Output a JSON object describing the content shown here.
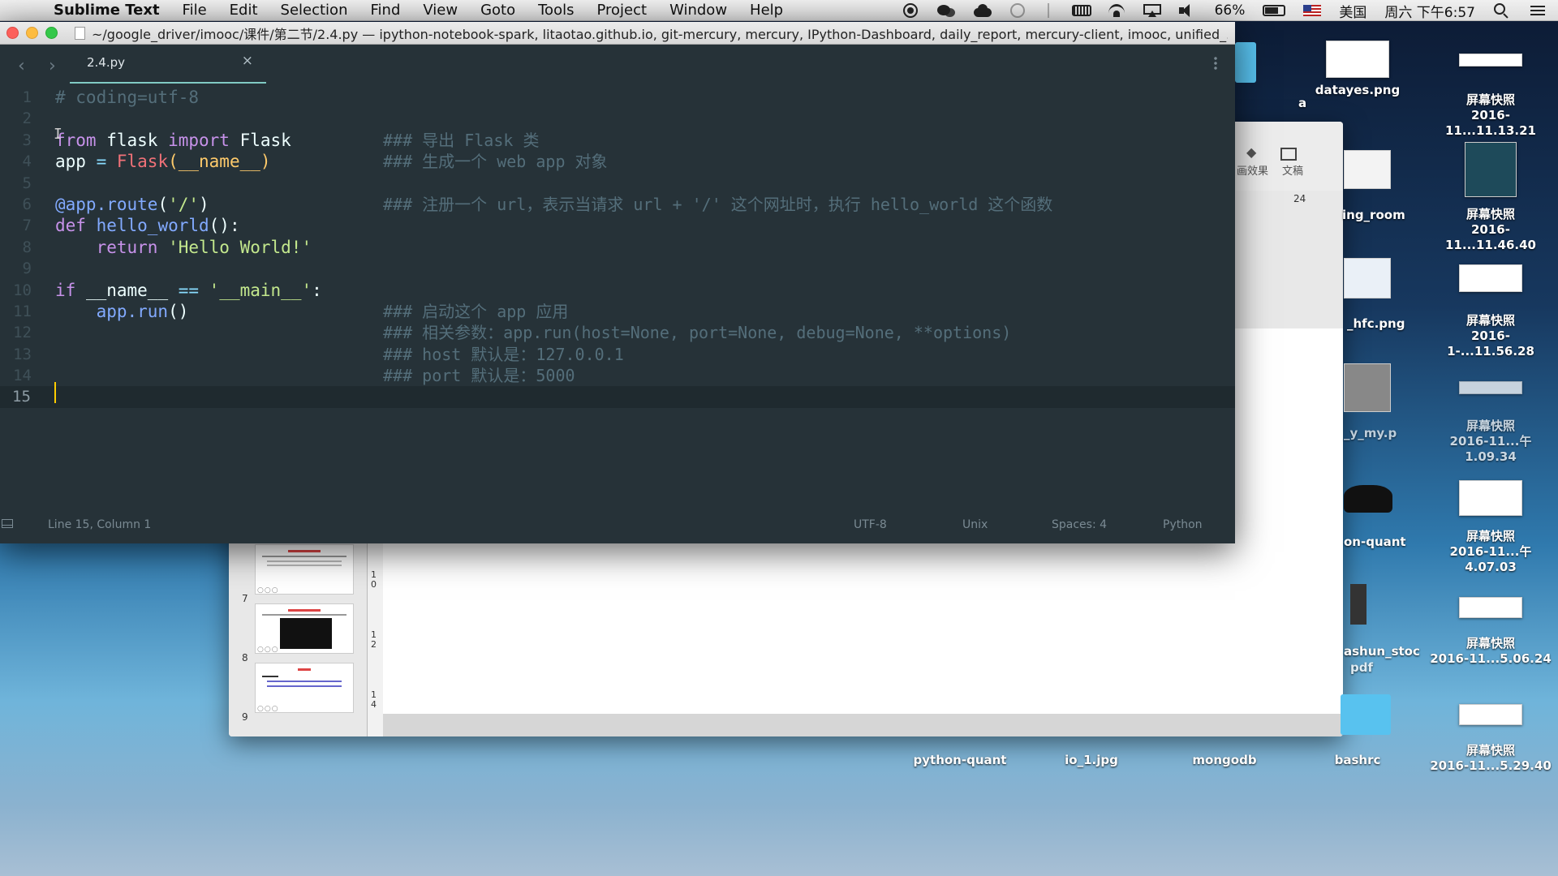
{
  "menubar": {
    "app_name": "Sublime Text",
    "items": [
      "File",
      "Edit",
      "Selection",
      "Find",
      "View",
      "Goto",
      "Tools",
      "Project",
      "Window",
      "Help"
    ],
    "battery": "66%",
    "input_source": "美国",
    "clock": "周六 下午6:57"
  },
  "window": {
    "title": "~/google_driver/imooc/课件/第二节/2.4.py — ipython-notebook-spark, litaotao.github.io, git-mercury, mercury, IPython-Dashboard, daily_report, mercury-client, imooc, unified_..."
  },
  "tab": {
    "label": "2.4.py",
    "close": "×"
  },
  "editor": {
    "line_numbers": [
      "1",
      "2",
      "3",
      "4",
      "5",
      "6",
      "7",
      "8",
      "9",
      "10",
      "11",
      "12",
      "13",
      "14",
      "15"
    ],
    "active_line": "15",
    "code": {
      "l1": "# coding=utf-8",
      "l3_kw_from": "from",
      "l3_mod": " flask ",
      "l3_kw_import": "import",
      "l3_cls": " Flask",
      "l4_var": "app ",
      "l4_op": "=",
      "l4_call": " Flask",
      "l4_args": "(__name__)",
      "l6_deco": "@app.route",
      "l6_args_open": "(",
      "l6_str": "'/'",
      "l6_args_close": ")",
      "l7_kw": "def",
      "l7_fn": " hello_world",
      "l7_rest": "():",
      "l8_kw": "    return",
      "l8_str": " 'Hello World!'",
      "l10_kw": "if",
      "l10_var": " __name__ ",
      "l10_op": "==",
      "l10_str": " '__main__'",
      "l10_rest": ":",
      "l11_indent": "    ",
      "l11_call": "app.run",
      "l11_rest": "()"
    },
    "comments": {
      "c3": "### 导出 Flask 类",
      "c4": "### 生成一个 web app 对象",
      "c6": "### 注册一个 url，表示当请求 url + '/' 这个网址时，执行 hello_world 这个函数",
      "c11": "### 启动这个 app 应用",
      "c12": "### 相关参数：app.run(host=None, port=None, debug=None, **options)",
      "c13": "### host 默认是：127.0.0.1",
      "c14": "### port 默认是：5000"
    }
  },
  "statusbar": {
    "position": "Line 15, Column 1",
    "encoding": "UTF-8",
    "line_endings": "Unix",
    "indentation": "Spaces: 4",
    "syntax": "Python"
  },
  "background_window": {
    "toolbar_labels": [
      "画效果",
      "文稿"
    ],
    "ruler_value": "24",
    "vruler": [
      "1",
      "0",
      "1",
      "2",
      "1",
      "4"
    ],
    "slides": [
      {
        "num": "7",
        "dots": "○○○"
      },
      {
        "num": "8",
        "dots": "○○○"
      },
      {
        "num": "9",
        "dots": "○○○"
      }
    ]
  },
  "desktop": {
    "right_column": [
      {
        "line1": "屏幕快照",
        "line2": "2016-11...11.13.21"
      },
      {
        "line1": "屏幕快照",
        "line2": "2016-11...11.46.40"
      },
      {
        "line1": "屏幕快照",
        "line2": "2016-1-...11.56.28"
      },
      {
        "line1": "屏幕快照",
        "line2": "2016-11...午1.09.34"
      },
      {
        "line1": "屏幕快照",
        "line2": "2016-11...午4.07.03"
      },
      {
        "line1": "屏幕快照",
        "line2": "2016-11...5.06.24"
      },
      {
        "line1": "屏幕快照",
        "line2": "2016-11...5.29.40"
      }
    ],
    "mid_column": [
      "a",
      "datayes.png",
      "ing_room",
      "_hfc.png",
      "_y_my.p",
      "on-quant",
      "ashun_stoc",
      "pdf"
    ],
    "bottom_row": [
      "python-quant",
      "io_1.jpg",
      "mongodb",
      "bashrc"
    ]
  },
  "colors": {
    "editor_bg": "#263238",
    "keyword": "#c792ea",
    "string": "#c3e88d",
    "function": "#82aaff",
    "comment": "#546e7a",
    "tab_accent": "#80cbc4",
    "caret": "#ffcc00"
  }
}
